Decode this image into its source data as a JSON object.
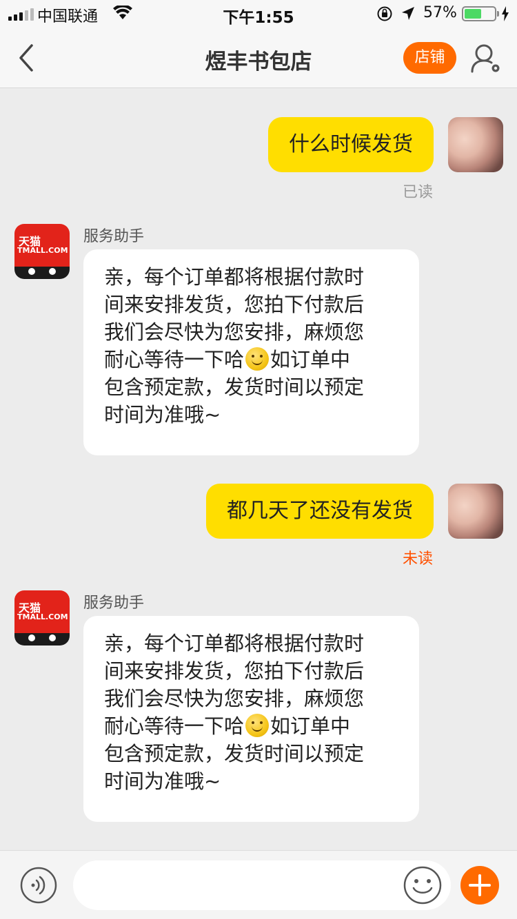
{
  "status_bar": {
    "carrier": "中国联通",
    "time": "下午1:55",
    "battery_percent_text": "57%",
    "battery_level": 0.57
  },
  "nav": {
    "title": "煜丰书包店",
    "shop_button": "店铺",
    "accent_color": "#ff6a00"
  },
  "messages": [
    {
      "type": "outgoing",
      "text": "什么时候发货",
      "status": "已读",
      "status_color": "#999999"
    },
    {
      "type": "incoming",
      "sender": "服务助手",
      "avatar_text_cn": "天猫",
      "avatar_text_en": "TMALL.COM",
      "lines": [
        "亲，每个订单都将根据付款时",
        "间来安排发货，您拍下付款后",
        "我们会尽快为您安排，麻烦您",
        [
          "耐心等待一下哈",
          "如订单中"
        ],
        "包含预定款，发货时间以预定",
        "时间为准哦~"
      ]
    },
    {
      "type": "outgoing",
      "text": "都几天了还没有发货",
      "status": "未读",
      "status_color": "#ff5000"
    },
    {
      "type": "incoming",
      "sender": "服务助手",
      "avatar_text_cn": "天猫",
      "avatar_text_en": "TMALL.COM",
      "lines": [
        "亲，每个订单都将根据付款时",
        "间来安排发货，您拍下付款后",
        "我们会尽快为您安排，麻烦您",
        [
          "耐心等待一下哈",
          "如订单中"
        ],
        "包含预定款，发货时间以预定",
        "时间为准哦~"
      ]
    }
  ],
  "input_bar": {
    "value": "",
    "placeholder": ""
  }
}
